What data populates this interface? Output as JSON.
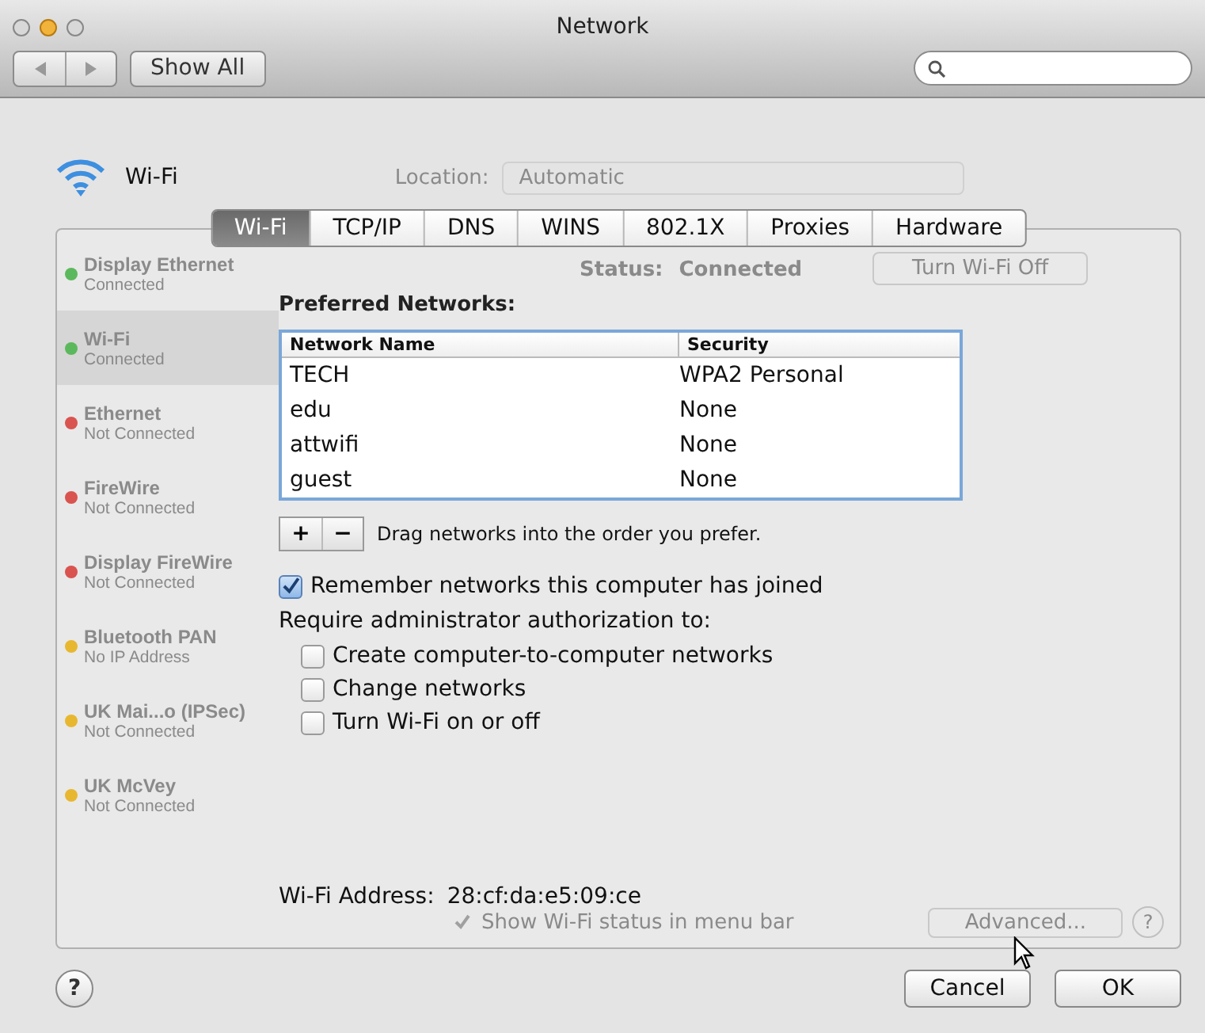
{
  "window": {
    "title": "Network",
    "show_all": "Show All"
  },
  "header": {
    "service": "Wi-Fi",
    "location_label": "Location:",
    "location_value": "Automatic"
  },
  "background": {
    "services": [
      {
        "name": "Display Ethernet",
        "status": "Connected",
        "color": "#5cb85c",
        "selected": false
      },
      {
        "name": "Wi-Fi",
        "status": "Connected",
        "color": "#5cb85c",
        "selected": true
      },
      {
        "name": "Ethernet",
        "status": "Not Connected",
        "color": "#d9534f",
        "selected": false
      },
      {
        "name": "FireWire",
        "status": "Not Connected",
        "color": "#d9534f",
        "selected": false
      },
      {
        "name": "Display FireWire",
        "status": "Not Connected",
        "color": "#d9534f",
        "selected": false
      },
      {
        "name": "Bluetooth PAN",
        "status": "No IP Address",
        "color": "#e8b730",
        "selected": false
      },
      {
        "name": "UK Mai...o (IPSec)",
        "status": "Not Connected",
        "color": "#e8b730",
        "selected": false
      },
      {
        "name": "UK McVey",
        "status": "Not Connected",
        "color": "#e8b730",
        "selected": false
      }
    ],
    "status_label": "Status:",
    "status_value": "Connected",
    "turn_off": "Turn Wi-Fi Off",
    "show_status": {
      "label": "Show Wi-Fi status in menu bar",
      "checked": true
    },
    "advanced": "Advanced...",
    "help": "?"
  },
  "sheet": {
    "tabs": [
      {
        "label": "Wi-Fi",
        "selected": true
      },
      {
        "label": "TCP/IP",
        "selected": false
      },
      {
        "label": "DNS",
        "selected": false
      },
      {
        "label": "WINS",
        "selected": false
      },
      {
        "label": "802.1X",
        "selected": false
      },
      {
        "label": "Proxies",
        "selected": false
      },
      {
        "label": "Hardware",
        "selected": false
      }
    ],
    "preferred_label": "Preferred Networks:",
    "table": {
      "columns": [
        "Network Name",
        "Security"
      ],
      "rows": [
        [
          "TECH",
          "WPA2 Personal"
        ],
        [
          "edu",
          "None"
        ],
        [
          "attwifi",
          "None"
        ],
        [
          "guest",
          "None"
        ]
      ]
    },
    "add": "+",
    "remove": "−",
    "drag_hint": "Drag networks into the order you prefer.",
    "remember": {
      "label": "Remember networks this computer has joined",
      "checked": true
    },
    "require_label": "Require administrator authorization to:",
    "options": [
      {
        "label": "Create computer-to-computer networks",
        "checked": false
      },
      {
        "label": "Change networks",
        "checked": false
      },
      {
        "label": "Turn Wi-Fi on or off",
        "checked": false
      }
    ],
    "address_label": "Wi-Fi Address:",
    "address": "28:cf:da:e5:09:ce",
    "help": "?",
    "buttons": [
      "Cancel",
      "OK"
    ]
  }
}
